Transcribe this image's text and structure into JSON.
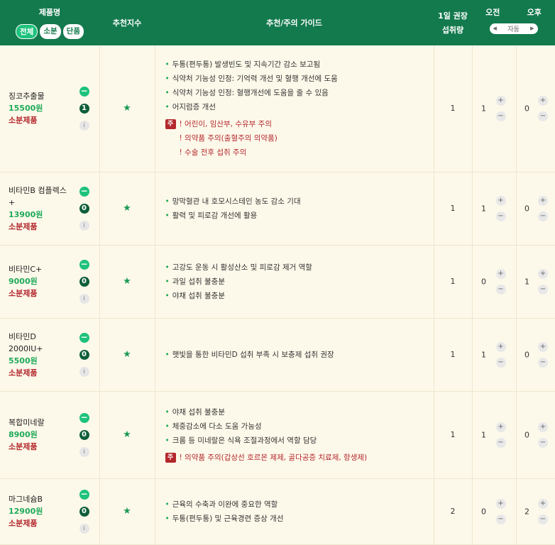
{
  "header": {
    "product_name": "제품명",
    "filters": [
      "전체",
      "소분",
      "단품"
    ],
    "recommend": "추천지수",
    "guide": "추천/주의 가이드",
    "daily_line1": "1일 권장",
    "daily_line2": "섭취량",
    "am": "오전",
    "pm": "오후",
    "mode_label": "자동"
  },
  "products": [
    {
      "name": "징코추출물",
      "price": "15500원",
      "type": "소분제품",
      "count": "1",
      "guides": [
        "두통(편두통) 발생빈도 및 지속기간 감소 보고됨",
        "식약처 기능성 인정: 기억력 개선 및 혈행 개선에 도움",
        "식약처 기능성 인정: 혈행개선에 도움을 줄 수 있음",
        "어지럼증 개선"
      ],
      "warning_badge": "주",
      "warnings": [
        "! 어린이, 임산부, 수유부 주의",
        "! 의약품 주의(출혈주의 의약품)",
        "! 수술 전후 섭취 주의"
      ],
      "daily": "1",
      "am": "1",
      "pm": "0"
    },
    {
      "name": "비타민B 컴플렉스+",
      "price": "13900원",
      "type": "소분제품",
      "count": "0",
      "guides": [
        "망막혈관 내 호모시스테인 농도 감소 기대",
        "활력 및 피로감 개선에 활용"
      ],
      "warning_badge": "",
      "warnings": [],
      "daily": "1",
      "am": "1",
      "pm": "0"
    },
    {
      "name": "비타민C+",
      "price": "9000원",
      "type": "소분제품",
      "count": "0",
      "guides": [
        "고강도 운동 시 활성산소 및 피로감 제거 역할",
        "과일 섭취 불충분",
        "야채 섭취 불충분"
      ],
      "warning_badge": "",
      "warnings": [],
      "daily": "1",
      "am": "0",
      "pm": "1"
    },
    {
      "name": "비타민D 2000IU+",
      "price": "5500원",
      "type": "소분제품",
      "count": "0",
      "guides": [
        "햇빛을 통한 비타민D 섭취 부족 시 보충제 섭취 권장"
      ],
      "warning_badge": "",
      "warnings": [],
      "daily": "1",
      "am": "1",
      "pm": "0"
    },
    {
      "name": "복합미네랄",
      "price": "8900원",
      "type": "소분제품",
      "count": "0",
      "guides": [
        "야채 섭취 불충분",
        "체중감소에 다소 도움 가능성",
        "크롬 등 미네랄은 식욕 조절과정에서 역할 담당"
      ],
      "warning_badge": "주",
      "warnings": [
        "! 의약품 주의(갑상선 호르몬 제제, 골다공증 치료제, 항생제)"
      ],
      "daily": "1",
      "am": "1",
      "pm": "0"
    },
    {
      "name": "마그네슘B",
      "price": "12900원",
      "type": "소분제품",
      "count": "0",
      "guides": [
        "근육의 수축과 이완에 중요한 역할",
        "두통(편두통) 및 근육경련 증상 개선"
      ],
      "warning_badge": "",
      "warnings": [],
      "daily": "2",
      "am": "0",
      "pm": "2"
    }
  ]
}
